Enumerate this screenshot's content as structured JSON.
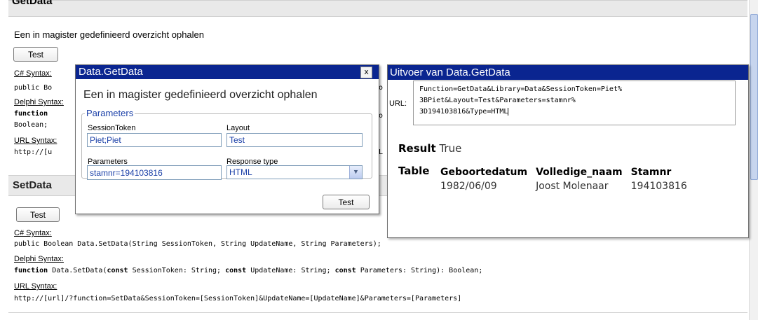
{
  "page": {
    "top_section_title": "GetData",
    "getdata_description": "Een in magister gedefinieerd overzicht ophalen",
    "test_button": "Test",
    "csharp_label": "C# Syntax:",
    "delphi_label": "Delphi Syntax:",
    "url_label": "URL Syntax:",
    "getdata_partial": {
      "csharp_line": "public Bo",
      "delphi_line": "function",
      "delphi_line2": "Boolean;",
      "url_line": "http://[u"
    },
    "setdata_section": {
      "title": "SetData",
      "csharp_code": "public Boolean Data.SetData(String SessionToken, String UpdateName, String Parameters);",
      "delphi_code": "function Data.SetData(const SessionToken: String; const UpdateName: String; const Parameters: String): Boolean;",
      "delphi_kw_function": "function",
      "delphi_part1": " Data.SetData(",
      "delphi_kw_const": "const",
      "delphi_part2": " SessionToken: String; ",
      "delphi_part3": " UpdateName: String; ",
      "delphi_part4": " Parameters: String): Boolean;",
      "url_code": "http://[url]/?function=SetData&SessionToken=[SessionToken]&UpdateName=[UpdateName]&Parameters=[Parameters]"
    }
  },
  "dialog": {
    "title": "Data.GetData",
    "close_glyph": "x",
    "description": "Een in magister gedefinieerd overzicht ophalen",
    "legend": "Parameters",
    "session_token_label": "SessionToken",
    "session_token_value": "Piet;Piet",
    "layout_label": "Layout",
    "layout_value": "Test",
    "parameters_label": "Parameters",
    "parameters_value": "stamnr=194103816",
    "response_type_label": "Response type",
    "response_type_value": "HTML",
    "test_button": "Test"
  },
  "output": {
    "title": "Uitvoer van Data.GetData",
    "url_label": "URL:",
    "url_lines": [
      "Function=GetData&Library=Data&SessionToken=Piet%",
      "3BPiet&Layout=Test&Parameters=stamnr%",
      "3D194103816&Type=HTML"
    ],
    "result_label": "Result",
    "result_value": "True",
    "table_label": "Table",
    "table": {
      "headers": [
        "Geboortedatum",
        "Volledige_naam",
        "Stamnr"
      ],
      "rows": [
        [
          "1982/06/09",
          "Joost Molenaar",
          "194103816"
        ]
      ]
    }
  },
  "colors": {
    "title_bar": "#0a2590",
    "field_text": "#1b40a8"
  }
}
